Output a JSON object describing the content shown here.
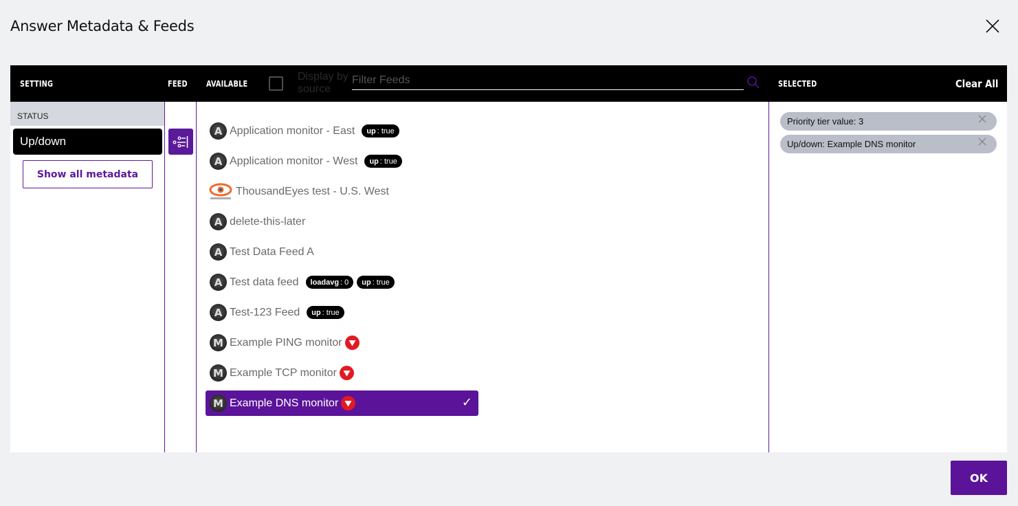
{
  "dialog": {
    "title": "Answer Metadata & Feeds",
    "close_icon": "close-icon"
  },
  "header": {
    "setting_label": "SETTING",
    "feed_label": "FEED",
    "available_label": "AVAILABLE",
    "display_by_source_label": "Display by source",
    "display_by_source_checked": false,
    "filter_placeholder": "Filter Feeds",
    "filter_value": "",
    "search_icon": "search-icon",
    "selected_label": "SELECTED",
    "clear_all_label": "Clear All"
  },
  "settings": {
    "group_label": "STATUS",
    "items": [
      {
        "label": "Up/down",
        "active": true
      }
    ],
    "show_all_label": "Show all metadata"
  },
  "feed_filter_icon": "filter-sliders-icon",
  "feeds": [
    {
      "name": "Application monitor - East",
      "icon": "A",
      "icon_type": "app-monitor-icon",
      "tags": [
        {
          "key": "up",
          "value": "true"
        }
      ],
      "down": false,
      "selected": false
    },
    {
      "name": "Application monitor - West",
      "icon": "A",
      "icon_type": "app-monitor-icon",
      "tags": [
        {
          "key": "up",
          "value": "true"
        }
      ],
      "down": false,
      "selected": false
    },
    {
      "name": "ThousandEyes test - U.S. West",
      "icon": "TE",
      "icon_type": "thousandeyes-icon",
      "tags": [],
      "down": false,
      "selected": false
    },
    {
      "name": "delete-this-later",
      "icon": "A",
      "icon_type": "app-monitor-icon",
      "tags": [],
      "down": false,
      "selected": false
    },
    {
      "name": "Test Data Feed A",
      "icon": "A",
      "icon_type": "app-monitor-icon",
      "tags": [],
      "down": false,
      "selected": false
    },
    {
      "name": "Test data feed",
      "icon": "A",
      "icon_type": "app-monitor-icon",
      "tags": [
        {
          "key": "loadavg",
          "value": "0"
        },
        {
          "key": "up",
          "value": "true"
        }
      ],
      "down": false,
      "selected": false
    },
    {
      "name": "Test-123 Feed",
      "icon": "A",
      "icon_type": "app-monitor-icon",
      "tags": [
        {
          "key": "up",
          "value": "true"
        }
      ],
      "down": false,
      "selected": false
    },
    {
      "name": "Example PING monitor",
      "icon": "M",
      "icon_type": "monitor-icon",
      "tags": [],
      "down": true,
      "selected": false
    },
    {
      "name": "Example TCP monitor",
      "icon": "M",
      "icon_type": "monitor-icon",
      "tags": [],
      "down": true,
      "selected": false
    },
    {
      "name": "Example DNS monitor",
      "icon": "M",
      "icon_type": "monitor-icon",
      "tags": [],
      "down": true,
      "selected": true
    }
  ],
  "selected_chips": [
    {
      "key": "Priority tier value:",
      "value": "3"
    },
    {
      "key": "Up/down:",
      "value": "Example DNS monitor"
    }
  ],
  "footer": {
    "ok_label": "OK"
  },
  "colors": {
    "accent": "#5b139a",
    "down_red": "#e21a23",
    "header_bg": "#000000",
    "chip_bg": "#b9bec9",
    "page_bg": "#f0f1f3"
  }
}
